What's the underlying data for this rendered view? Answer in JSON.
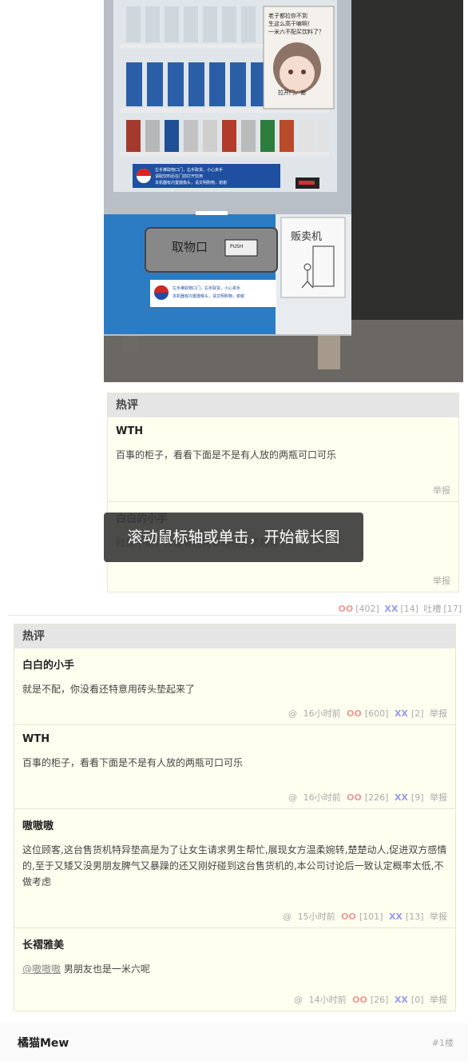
{
  "photo": {
    "sign_text": "老子都拉你不到\n生这么高干嘛啊！\n一米六不配买饮料了？",
    "bubble_text": "拉开门，谢",
    "outlet_label": "取物口",
    "push_label": "PUSH",
    "vending_note": "贩卖机",
    "notice_top": "左手推取物口门，右手取货，小心夹手\n请取饮料后在门前打开饮用\n本机器有内置摄像头，请文明购物，谢谢",
    "notice_bottom": "左手推取物口门，右手取货，小心夹手\n本机器有内置摄像头，请文明购物，谢谢",
    "brand": "PEPSI"
  },
  "hot_panel_1": {
    "header": "热评",
    "comments": [
      {
        "author": "WTH",
        "text": "百事的柜子，看看下面是不是有人放的两瓶可口可乐",
        "report": "举报"
      },
      {
        "author": "白白的小手",
        "text": "就是不配，你没看还特意用砖头垫起来了",
        "report": "举报"
      }
    ]
  },
  "toast": {
    "text": "滚动鼠标轴或单击，开始截长图"
  },
  "post_votes": {
    "oo": "OO",
    "oo_count": "[402]",
    "xx": "XX",
    "xx_count": "[14]",
    "tucao": "吐槽",
    "tucao_count": "[17]"
  },
  "hot_panel_2": {
    "header": "热评",
    "comments": [
      {
        "author": "白白的小手",
        "text": "就是不配，你没看还特意用砖头垫起来了",
        "at": "@",
        "time": "16小时前",
        "oo": "OO",
        "oo_count": "[600]",
        "xx": "XX",
        "xx_count": "[2]",
        "report": "举报"
      },
      {
        "author": "WTH",
        "text": "百事的柜子，看看下面是不是有人放的两瓶可口可乐",
        "at": "@",
        "time": "16小时前",
        "oo": "OO",
        "oo_count": "[226]",
        "xx": "XX",
        "xx_count": "[9]",
        "report": "举报"
      },
      {
        "author": "嗷嗷嗷",
        "text": "这位顾客,这台售货机特异垫高是为了让女生请求男生帮忙,展现女方温柔婉转,楚楚动人,促进双方感情的,至于又矮又没男朋友脾气又暴躁的还又刚好碰到这台售货机的,本公司讨论后一致认定概率太低,不做考虑",
        "at": "@",
        "time": "15小时前",
        "oo": "OO",
        "oo_count": "[101]",
        "xx": "XX",
        "xx_count": "[13]",
        "report": "举报"
      },
      {
        "author": "长褶雅美",
        "mention": "@嗷嗷嗷",
        "text": " 男朋友也是一米六呢",
        "at": "@",
        "time": "14小时前",
        "oo": "OO",
        "oo_count": "[26]",
        "xx": "XX",
        "xx_count": "[0]",
        "report": "举报"
      }
    ]
  },
  "next_post": {
    "author": "橘猫Mew",
    "floor": "#1楼"
  }
}
